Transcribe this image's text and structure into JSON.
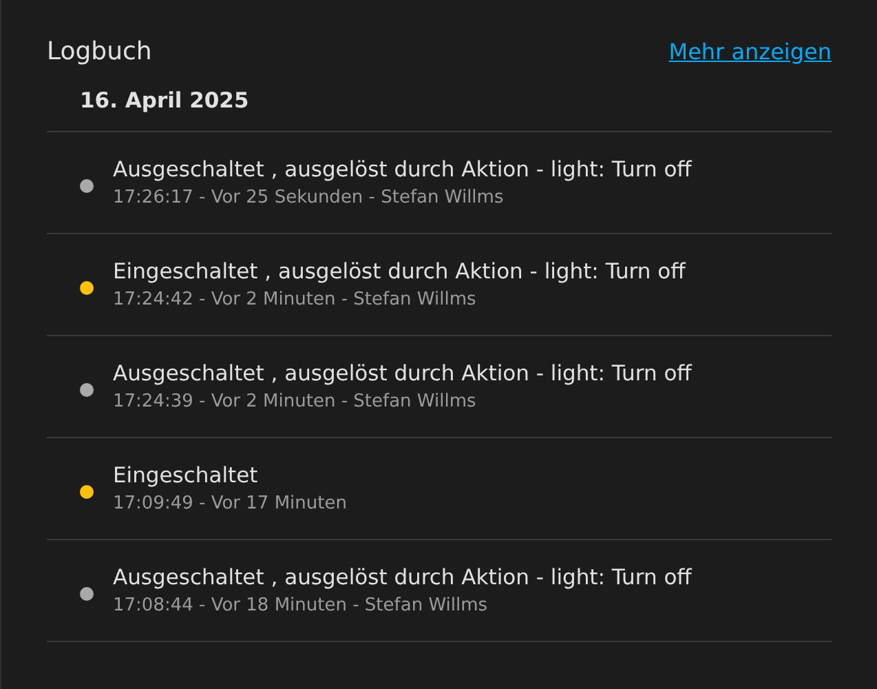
{
  "card": {
    "title": "Logbuch",
    "more_link": "Mehr anzeigen"
  },
  "date": "16. April 2025",
  "entries": [
    {
      "message": "Ausgeschaltet , ausgelöst durch Aktion - light: Turn off",
      "meta": "17:26:17 - Vor 25 Sekunden - Stefan Willms",
      "color": "#a9a9a9"
    },
    {
      "message": "Eingeschaltet , ausgelöst durch Aktion - light: Turn off",
      "meta": "17:24:42 - Vor 2 Minuten - Stefan Willms",
      "color": "#ffc107"
    },
    {
      "message": "Ausgeschaltet , ausgelöst durch Aktion - light: Turn off",
      "meta": "17:24:39 - Vor 2 Minuten - Stefan Willms",
      "color": "#a9a9a9"
    },
    {
      "message": "Eingeschaltet",
      "meta": "17:09:49 - Vor 17 Minuten",
      "color": "#ffc107"
    },
    {
      "message": "Ausgeschaltet , ausgelöst durch Aktion - light: Turn off",
      "meta": "17:08:44 - Vor 18 Minuten - Stefan Willms",
      "color": "#a9a9a9"
    }
  ]
}
